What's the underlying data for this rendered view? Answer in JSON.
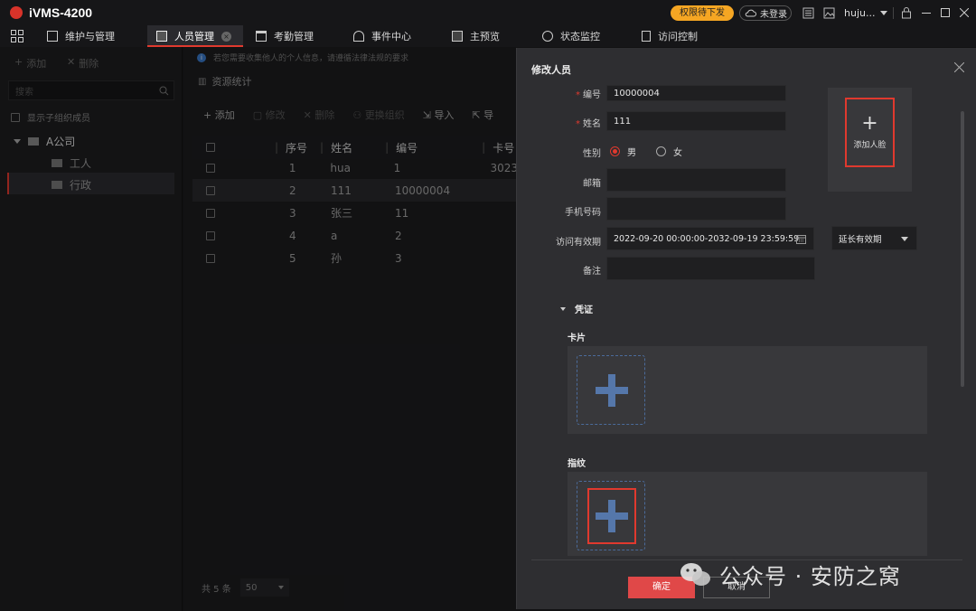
{
  "app": {
    "title": "iVMS-4200",
    "badge": "权限待下发",
    "cloud": "未登录",
    "user": "huju..."
  },
  "tabs": [
    {
      "label": "维护与管理"
    },
    {
      "label": "人员管理"
    },
    {
      "label": "考勤管理"
    },
    {
      "label": "事件中心"
    },
    {
      "label": "主预览"
    },
    {
      "label": "状态监控"
    },
    {
      "label": "访问控制"
    }
  ],
  "left": {
    "add": "添加",
    "delete": "删除",
    "search_placeholder": "搜索",
    "show_sub": "显示子组织成员",
    "tree": [
      {
        "label": "A公司"
      },
      {
        "label": "工人"
      },
      {
        "label": "行政"
      }
    ]
  },
  "main": {
    "notice": "若您需要收集他人的个人信息，请遵循法律法规的要求",
    "stats": "资源统计",
    "toolbar": {
      "add": "添加",
      "edit": "修改",
      "delete": "删除",
      "change_org": "更换组织",
      "import": "导入",
      "export": "导"
    },
    "columns": [
      "序号",
      "姓名",
      "编号",
      "卡号"
    ],
    "rows": [
      {
        "idx": "1",
        "name": "hua",
        "id": "1",
        "card": "3023"
      },
      {
        "idx": "2",
        "name": "111",
        "id": "10000004",
        "card": ""
      },
      {
        "idx": "3",
        "name": "张三",
        "id": "11",
        "card": ""
      },
      {
        "idx": "4",
        "name": "a",
        "id": "2",
        "card": ""
      },
      {
        "idx": "5",
        "name": "孙",
        "id": "3",
        "card": ""
      }
    ],
    "footer_total": "共 5 条",
    "page_size": "50"
  },
  "dialog": {
    "title": "修改人员",
    "fields": {
      "id_label": "编号",
      "id_value": "10000004",
      "name_label": "姓名",
      "name_value": "111",
      "gender_label": "性别",
      "male": "男",
      "female": "女",
      "email_label": "邮箱",
      "email_value": "",
      "phone_label": "手机号码",
      "phone_value": "",
      "validity_label": "访问有效期",
      "validity_value": "2022-09-20 00:00:00-2032-09-19 23:59:59",
      "extend": "延长有效期",
      "remark_label": "备注",
      "remark_value": ""
    },
    "face": "添加人脸",
    "credential": "凭证",
    "card": "卡片",
    "fingerprint": "指纹",
    "ok": "确定",
    "cancel": "取消"
  },
  "watermark": "公众号 · 安防之窝",
  "colors": {
    "accent_red": "#e0392e",
    "badge_orange": "#f5a623",
    "plus_blue": "#5577aa"
  }
}
